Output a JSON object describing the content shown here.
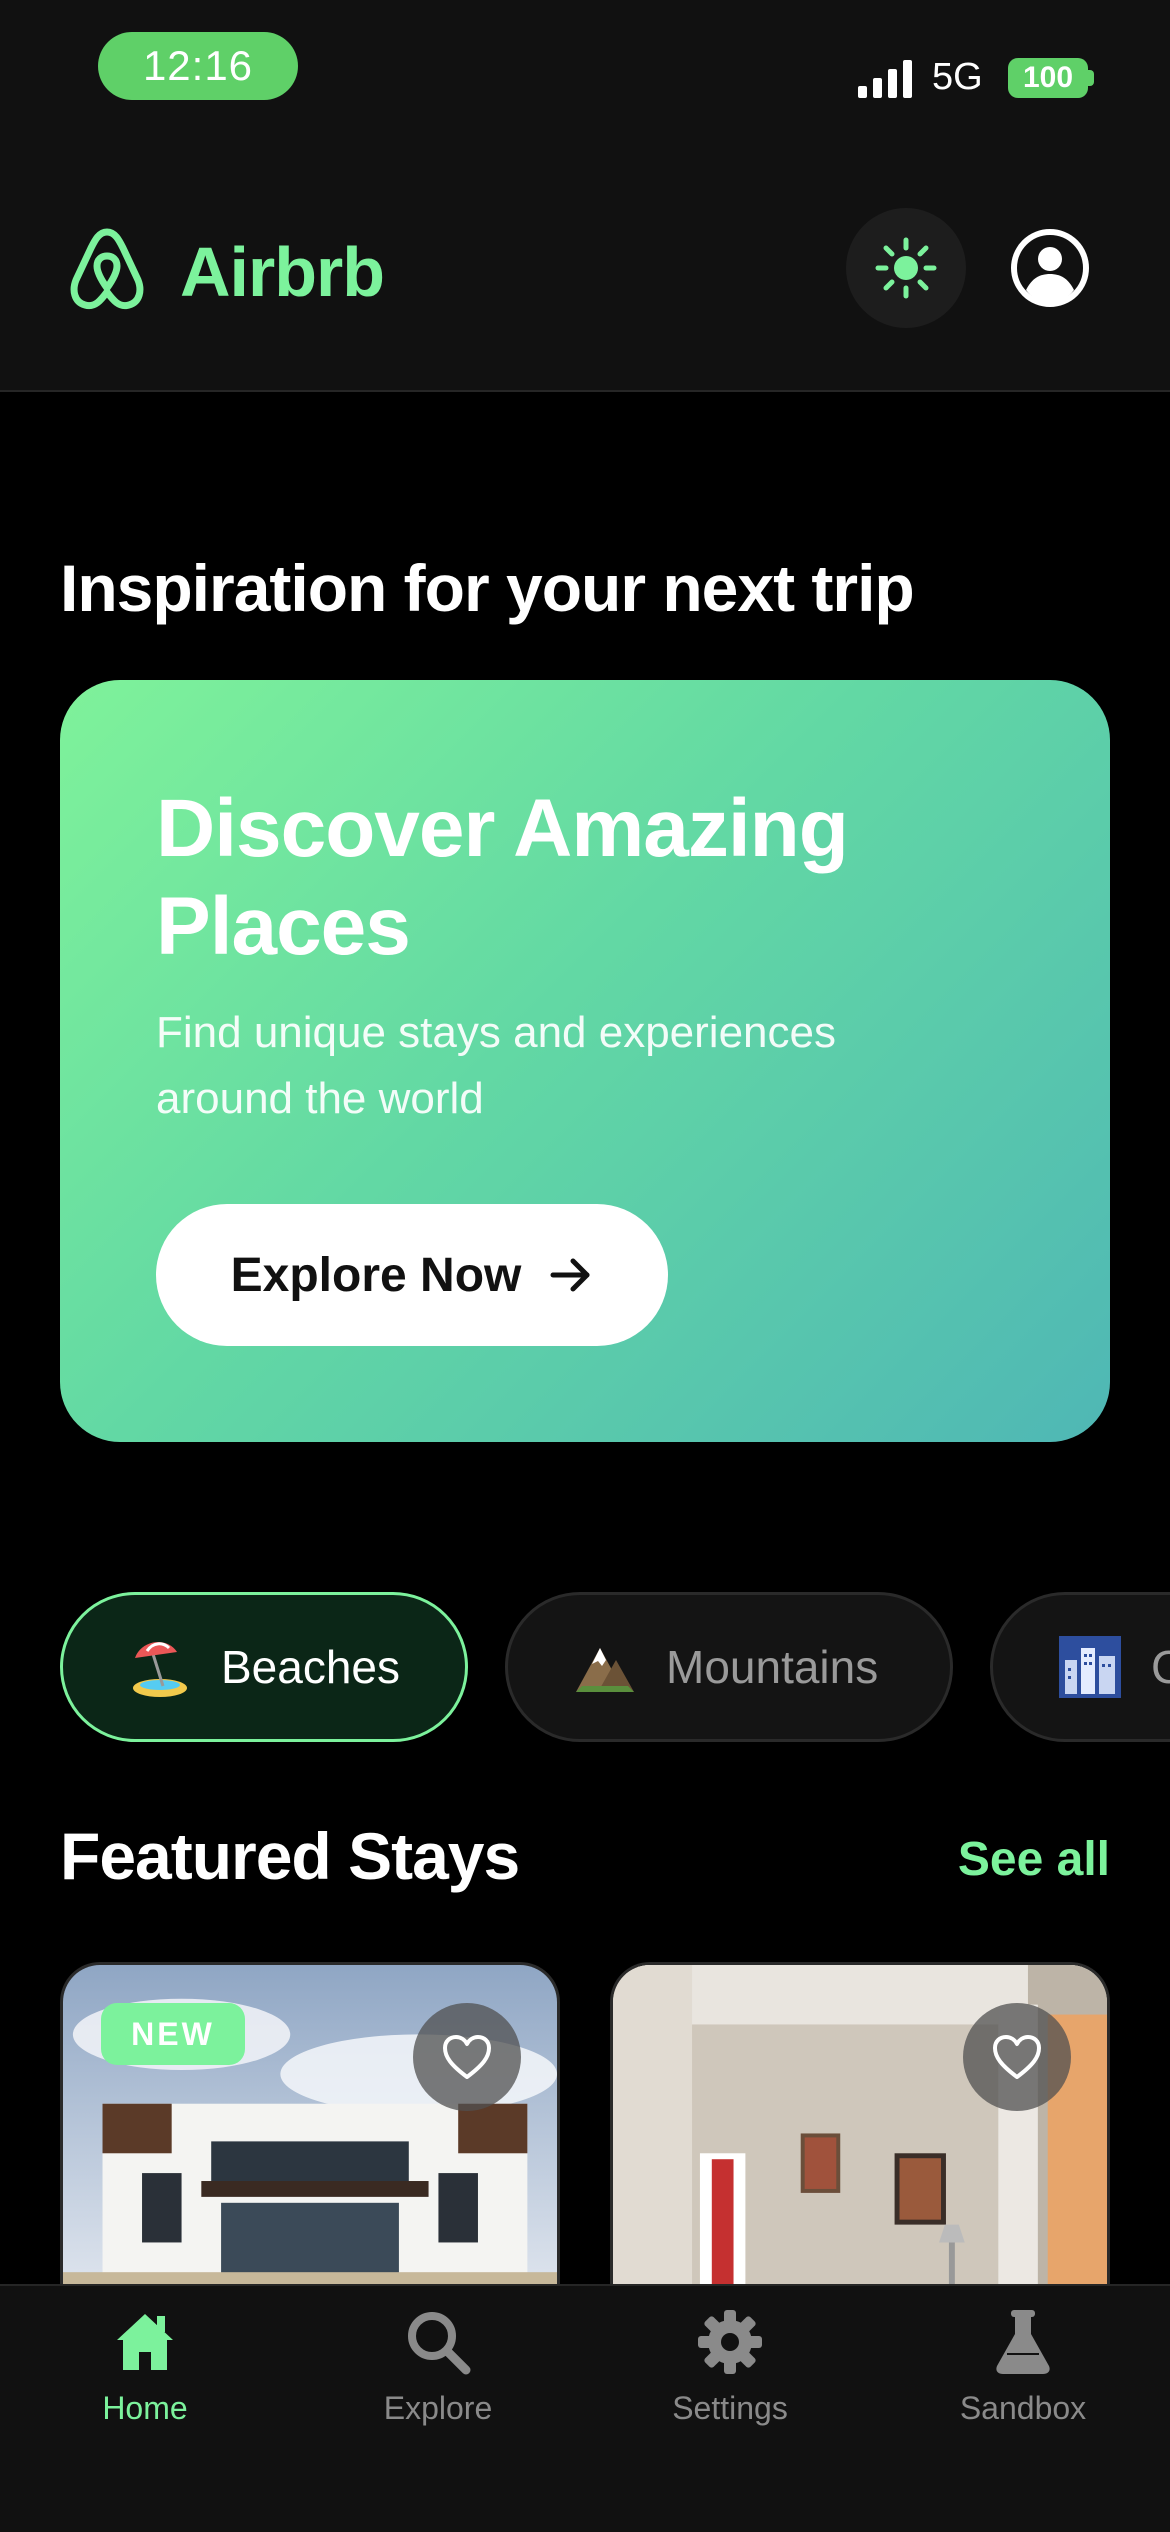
{
  "status_bar": {
    "time": "12:16",
    "network": "5G",
    "battery": "100"
  },
  "header": {
    "app_name": "Airbrb",
    "logo_icon": "airbnb-logo-icon",
    "theme_icon": "sun-icon",
    "profile_icon": "user-circle-icon"
  },
  "inspiration": {
    "section_title": "Inspiration for your next trip",
    "hero_title": "Discover Amazing Places",
    "hero_subtitle": "Find unique stays and experiences around the world",
    "cta_label": "Explore Now",
    "cta_icon": "arrow-right-icon"
  },
  "categories": [
    {
      "label": "Beaches",
      "emoji": "🏖️",
      "active": true
    },
    {
      "label": "Mountains",
      "emoji": "⛰️",
      "active": false
    },
    {
      "label": "C",
      "emoji": "🏙️",
      "active": false
    }
  ],
  "featured": {
    "title": "Featured Stays",
    "see_all": "See all",
    "cards": [
      {
        "badge": "NEW",
        "image": "modern-white-villa",
        "favorite_icon": "heart-outline-icon"
      },
      {
        "badge": "",
        "image": "bright-interior-room",
        "favorite_icon": "heart-outline-icon"
      }
    ]
  },
  "tab_bar": [
    {
      "label": "Home",
      "icon": "home-icon",
      "active": true
    },
    {
      "label": "Explore",
      "icon": "search-icon",
      "active": false
    },
    {
      "label": "Settings",
      "icon": "gear-icon",
      "active": false
    },
    {
      "label": "Sandbox",
      "icon": "flask-icon",
      "active": false
    }
  ],
  "colors": {
    "accent": "#7cf29c",
    "status_green": "#5fd068",
    "background": "#000000",
    "surface": "#111111"
  }
}
